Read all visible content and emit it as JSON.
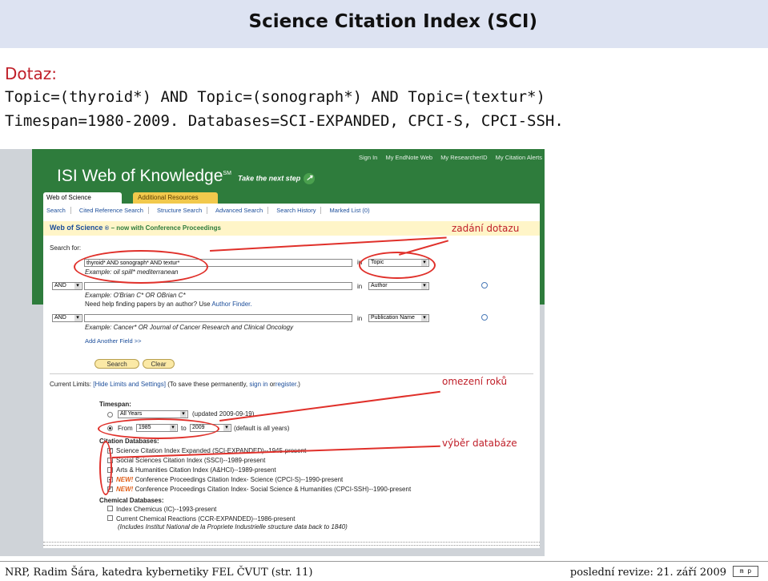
{
  "slide": {
    "title": "Science Citation Index (SCI)",
    "dotaz_label": "Dotaz:",
    "query_line1": "Topic=(thyroid*) AND Topic=(sonograph*) AND Topic=(textur*)",
    "query_line2": "Timespan=1980-2009. Databases=SCI-EXPANDED, CPCI-S, CPCI-SSH."
  },
  "isi": {
    "top_links": [
      "Sign In",
      "My EndNote Web",
      "My ResearcherID",
      "My Citation Alerts"
    ],
    "brand": "ISI Web of Knowledge",
    "brand_mark": "SM",
    "tagline": "Take the next step",
    "tabs": [
      "Web of Science",
      "Additional Resources"
    ],
    "subnav": [
      "Search",
      "Cited Reference Search",
      "Structure Search",
      "Advanced Search",
      "Search History",
      "Marked List (0)"
    ],
    "wos_title": "Web of Science",
    "wos_sub": "– now with Conference Proceedings",
    "search_for": "Search for:",
    "rows": [
      {
        "value": "thyroid* AND sonograph* AND textur*",
        "in": "in",
        "field": "Topic",
        "example": "Example: oil spill* mediterranean"
      },
      {
        "bool": "AND",
        "value": "",
        "in": "in",
        "field": "Author",
        "example": "Example: O'Brian C* OR OBrian C*",
        "help": "Need help finding papers by an author? Use",
        "help_link": "Author Finder."
      },
      {
        "bool": "AND",
        "value": "",
        "in": "in",
        "field": "Publication Name",
        "example": "Example: Cancer* OR Journal of Cancer Research and Clinical Oncology"
      }
    ],
    "add_field": "Add Another Field >>",
    "search_btn": "Search",
    "clear_btn": "Clear",
    "limits": {
      "label": "Current Limits:",
      "hide_link": "[Hide Limits and Settings]",
      "note": "(To save these permanently,",
      "note_link1": "sign in",
      "note_mid": "or",
      "note_link2": "register",
      "note_end": ".)",
      "timespan_label": "Timespan:",
      "all_years": "All Years",
      "updated": "(updated 2009-09-19)",
      "from_label": "From",
      "from_year": "1985",
      "to_label": "to",
      "to_year": "2009",
      "default": "(default is all years)",
      "citation_db_label": "Citation Databases:",
      "databases": [
        {
          "checked": true,
          "new": "",
          "text": "Science Citation Index Expanded (SCI-EXPANDED)--1945-present"
        },
        {
          "checked": false,
          "new": "",
          "text": "Social Sciences Citation Index (SSCI)--1989-present"
        },
        {
          "checked": false,
          "new": "",
          "text": "Arts & Humanities Citation Index (A&HCI)--1989-present"
        },
        {
          "checked": true,
          "new": "NEW!",
          "text": "Conference Proceedings Citation Index- Science (CPCI-S)--1990-present"
        },
        {
          "checked": true,
          "new": "NEW!",
          "text": "Conference Proceedings Citation Index- Social Science & Humanities (CPCI-SSH)--1990-present"
        }
      ],
      "chemical_db_label": "Chemical Databases:",
      "chem": [
        {
          "checked": false,
          "text": "Index Chemicus (IC)--1993-present"
        },
        {
          "checked": false,
          "text": "Current Chemical Reactions (CCR-EXPANDED)--1986-present",
          "sub": "(Includes Institut National de la Propriete Industrielle structure data back to 1840)"
        }
      ]
    }
  },
  "annotations": {
    "query": "zadání dotazu",
    "years": "omezení roků",
    "db": "výběr databáze"
  },
  "footer": {
    "left": "NRP, Radim Šára, katedra kybernetiky FEL ČVUT (str. 11)",
    "right": "poslední revize: 21. září 2009",
    "logo": "m p"
  }
}
